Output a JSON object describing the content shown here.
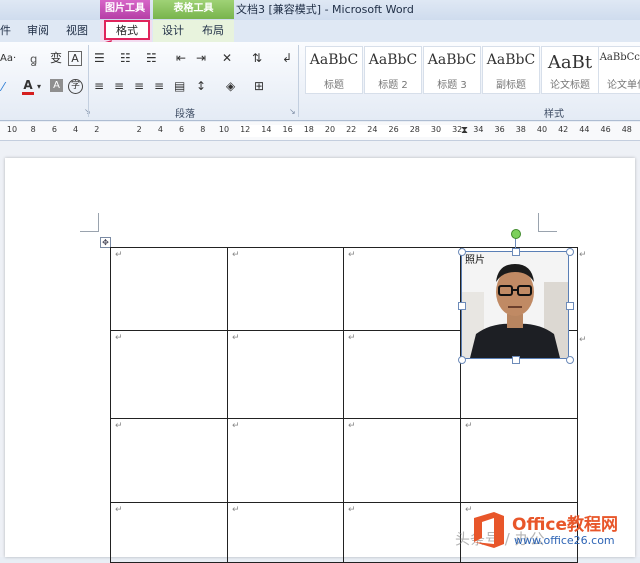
{
  "titlebar": {
    "picture_tools": "图片工具",
    "table_tools": "表格工具",
    "document_title": "文档3 [兼容模式] - Microsoft Word"
  },
  "tabs": {
    "left_cut": "件",
    "review": "审阅",
    "view": "视图",
    "format": "格式",
    "design": "设计",
    "layout": "布局"
  },
  "ribbon": {
    "font_size_partial": "Aa·",
    "paragraph_group": "段落",
    "styles_group": "样式",
    "styles": [
      {
        "preview": "AaBbC",
        "name": "标题"
      },
      {
        "preview": "AaBbC",
        "name": "标题 2"
      },
      {
        "preview": "AaBbC",
        "name": "标题 3"
      },
      {
        "preview": "AaBbC",
        "name": "副标题"
      },
      {
        "preview": "AaBt",
        "name": "论文标题"
      },
      {
        "preview": "AaBbCcDd",
        "name": "论文单位"
      }
    ]
  },
  "ruler": {
    "ticks": [
      "10",
      "8",
      "6",
      "4",
      "2",
      "",
      "2",
      "4",
      "6",
      "8",
      "10",
      "12",
      "14",
      "16",
      "18",
      "20",
      "22",
      "24",
      "26",
      "28",
      "30",
      "32",
      "34",
      "36",
      "38",
      "40",
      "42",
      "44",
      "46",
      "48"
    ]
  },
  "table": {
    "photo_label": "照片",
    "para_mark": "↵"
  },
  "watermark": {
    "brand": "Office教程网",
    "url": "www.office26.com",
    "tail": "头条号 / 办公"
  }
}
